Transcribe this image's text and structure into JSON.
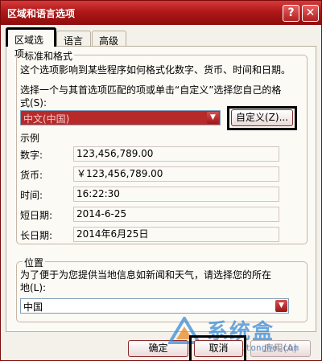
{
  "window": {
    "title": "区域和语言选项",
    "help_label": "?",
    "close_label": "✕"
  },
  "tabs": [
    {
      "label": "区域选项",
      "active": true
    },
    {
      "label": "语言",
      "active": false
    },
    {
      "label": "高级",
      "active": false
    }
  ],
  "standards": {
    "group_title": "标准和格式",
    "description": "这个选项影响到某些程序如何格式化数字、货币、时间和日期。",
    "select_prompt_line1": "选择一个与其首选项匹配的项或单击“自定义”选择您自己的格",
    "select_prompt_line2": "式(S):",
    "locale_value": "中文(中国)",
    "customize_label": "自定义(Z)..."
  },
  "samples": {
    "title": "示例",
    "rows": [
      {
        "label": "数字:",
        "value": "123,456,789.00"
      },
      {
        "label": "货币:",
        "value": "￥123,456,789.00"
      },
      {
        "label": "时间:",
        "value": "16:22:30"
      },
      {
        "label": "短日期:",
        "value": "2014-6-25"
      },
      {
        "label": "长日期:",
        "value": "2014年6月25日"
      }
    ]
  },
  "location": {
    "group_title": "位置",
    "description_line1": "为了便于为您提供当地信息如新闻和天气，请选择您的所在",
    "description_line2": "地(L):",
    "value": "中国"
  },
  "buttons": {
    "ok": "确定",
    "cancel": "取消",
    "apply": "应用(A)"
  },
  "watermark": {
    "brand": "系统盒",
    "url": "www.xitonghe.com"
  },
  "colors": {
    "title_bar": "#b01818",
    "highlight_outline": "#000000",
    "selected_locale_bg": "#b82a2a"
  }
}
